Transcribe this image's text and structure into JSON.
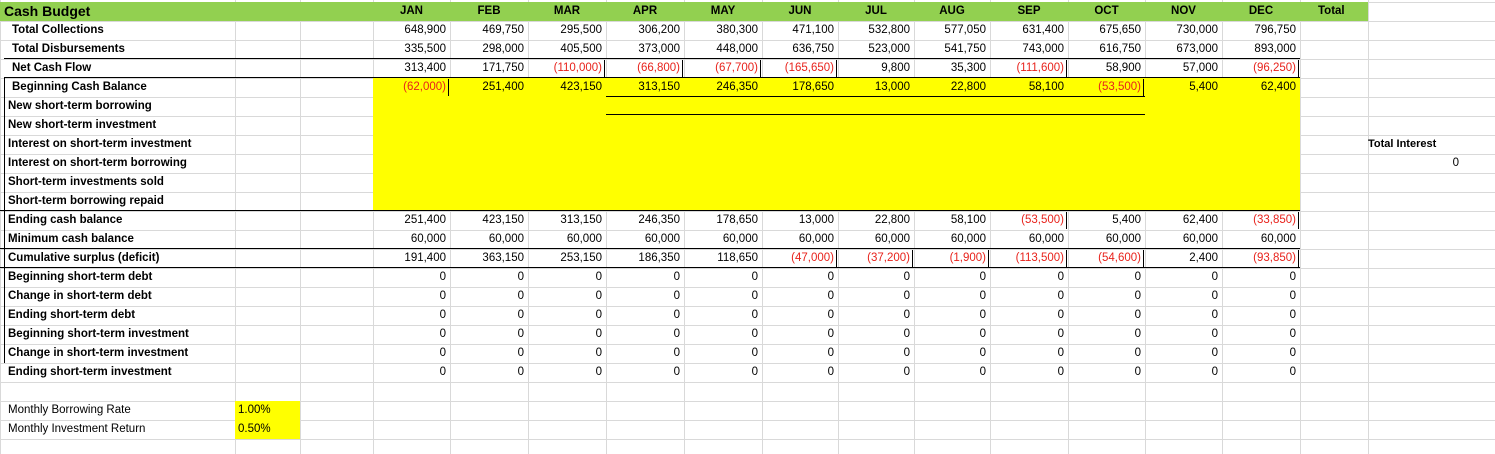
{
  "title": "Cash Budget",
  "months": [
    "JAN",
    "FEB",
    "MAR",
    "APR",
    "MAY",
    "JUN",
    "JUL",
    "AUG",
    "SEP",
    "OCT",
    "NOV",
    "DEC"
  ],
  "total_label": "Total",
  "rows": [
    {
      "label": "Total Collections",
      "values": [
        "648,900",
        "469,750",
        "295,500",
        "306,200",
        "380,300",
        "471,100",
        "532,800",
        "577,050",
        "631,400",
        "675,650",
        "730,000",
        "796,750"
      ]
    },
    {
      "label": "Total Disbursements",
      "values": [
        "335,500",
        "298,000",
        "405,500",
        "373,000",
        "448,000",
        "636,750",
        "523,000",
        "541,750",
        "743,000",
        "616,750",
        "673,000",
        "893,000"
      ]
    },
    {
      "label": "Net Cash Flow",
      "values": [
        "313,400",
        "171,750",
        "(110,000)",
        "(66,800)",
        "(67,700)",
        "(165,650)",
        "9,800",
        "35,300",
        "(111,600)",
        "58,900",
        "57,000",
        "(96,250)"
      ]
    },
    {
      "label": "Beginning Cash Balance",
      "values": [
        "(62,000)",
        "251,400",
        "423,150",
        "313,150",
        "246,350",
        "178,650",
        "13,000",
        "22,800",
        "58,100",
        "(53,500)",
        "5,400",
        "62,400"
      ]
    },
    {
      "label": "New short-term borrowing",
      "values": []
    },
    {
      "label": "New short-term investment",
      "values": []
    },
    {
      "label": "Interest on short-term investment",
      "values": []
    },
    {
      "label": "Interest on short-term borrowing",
      "values": []
    },
    {
      "label": "Short-term investments sold",
      "values": []
    },
    {
      "label": "Short-term borrowing repaid",
      "values": []
    },
    {
      "label": "Ending cash balance",
      "values": [
        "251,400",
        "423,150",
        "313,150",
        "246,350",
        "178,650",
        "13,000",
        "22,800",
        "58,100",
        "(53,500)",
        "5,400",
        "62,400",
        "(33,850)"
      ]
    },
    {
      "label": "Minimum cash balance",
      "values": [
        "60,000",
        "60,000",
        "60,000",
        "60,000",
        "60,000",
        "60,000",
        "60,000",
        "60,000",
        "60,000",
        "60,000",
        "60,000",
        "60,000"
      ]
    },
    {
      "label": "Cumulative surplus (deficit)",
      "values": [
        "191,400",
        "363,150",
        "253,150",
        "186,350",
        "118,650",
        "(47,000)",
        "(37,200)",
        "(1,900)",
        "(113,500)",
        "(54,600)",
        "2,400",
        "(93,850)"
      ]
    },
    {
      "label": "Beginning short-term debt",
      "values": [
        "0",
        "0",
        "0",
        "0",
        "0",
        "0",
        "0",
        "0",
        "0",
        "0",
        "0",
        "0"
      ]
    },
    {
      "label": "Change in short-term debt",
      "values": [
        "0",
        "0",
        "0",
        "0",
        "0",
        "0",
        "0",
        "0",
        "0",
        "0",
        "0",
        "0"
      ]
    },
    {
      "label": "Ending short-term debt",
      "values": [
        "0",
        "0",
        "0",
        "0",
        "0",
        "0",
        "0",
        "0",
        "0",
        "0",
        "0",
        "0"
      ]
    },
    {
      "label": "Beginning short-term investment",
      "values": [
        "0",
        "0",
        "0",
        "0",
        "0",
        "0",
        "0",
        "0",
        "0",
        "0",
        "0",
        "0"
      ]
    },
    {
      "label": "Change in short-term investment",
      "values": [
        "0",
        "0",
        "0",
        "0",
        "0",
        "0",
        "0",
        "0",
        "0",
        "0",
        "0",
        "0"
      ]
    },
    {
      "label": "Ending short-term investment",
      "values": [
        "0",
        "0",
        "0",
        "0",
        "0",
        "0",
        "0",
        "0",
        "0",
        "0",
        "0",
        "0"
      ]
    }
  ],
  "total_interest": {
    "label": "Total Interest",
    "value": "0"
  },
  "rates": [
    {
      "label": "Monthly Borrowing Rate",
      "value": "1.00%"
    },
    {
      "label": "Monthly Investment Return",
      "value": "0.50%"
    }
  ],
  "colors": {
    "header_green": "#92d050",
    "input_yellow": "#ffff00",
    "negative_red": "#e8221b",
    "gridline": "#d9d9d9"
  }
}
